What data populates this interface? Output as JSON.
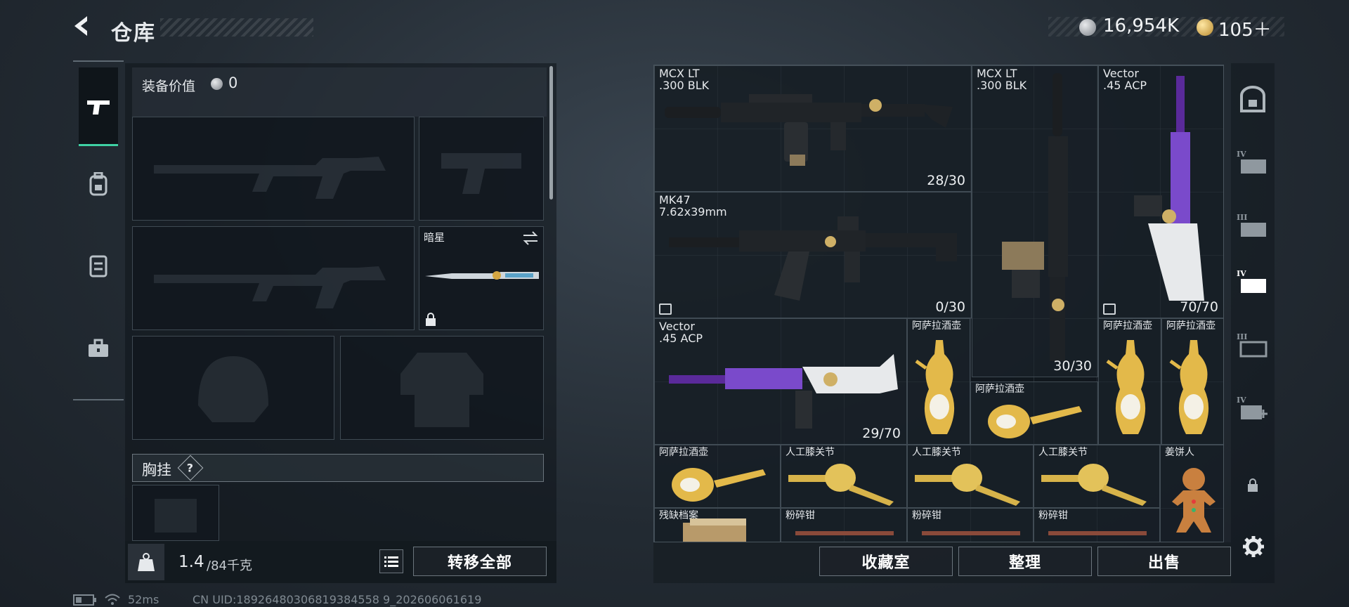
{
  "header": {
    "title": "仓库",
    "currency": [
      {
        "icon": "silver-coin-icon",
        "value": "16,954K"
      },
      {
        "icon": "gold-coin-icon",
        "value": "105＋"
      }
    ]
  },
  "left_tabs": [
    {
      "icon": "pistol-icon",
      "active": true
    },
    {
      "icon": "backpack-icon",
      "active": false
    },
    {
      "icon": "chest-rig-icon",
      "active": false
    },
    {
      "icon": "toolbox-icon",
      "active": false
    }
  ],
  "loadout": {
    "value_label": "装备价值",
    "value": "0",
    "secondary_melee": {
      "name": "暗星",
      "icon": "swap-icon"
    },
    "chest_rig_label": "胸挂",
    "help_icon": "?",
    "weight_current": "1.4",
    "weight_max": "/84千克",
    "transfer_all": "转移全部"
  },
  "grid_items": [
    {
      "name": "MCX LT",
      "sub": ".300 BLK",
      "count": "28/30",
      "kind": "rifle-black"
    },
    {
      "name": "MCX LT",
      "sub": ".300 BLK",
      "count": "30/30",
      "kind": "rifle-black-vertical"
    },
    {
      "name": "Vector",
      "sub": ".45 ACP",
      "count": "70/70",
      "kind": "smg-purple-vertical"
    },
    {
      "name": "MK47",
      "sub": "7.62x39mm",
      "count": "0/30",
      "kind": "rifle-black"
    },
    {
      "name": "Vector",
      "sub": ".45 ACP",
      "count": "29/70",
      "kind": "smg-purple"
    },
    {
      "name": "阿萨拉酒壶",
      "kind": "ewer-upright"
    },
    {
      "name": "阿萨拉酒壶",
      "kind": "ewer-upright"
    },
    {
      "name": "阿萨拉酒壶",
      "kind": "ewer-upright"
    },
    {
      "name": "阿萨拉酒壶",
      "kind": "ewer-lying"
    },
    {
      "name": "阿萨拉酒壶",
      "kind": "ewer-lying"
    },
    {
      "name": "人工膝关节",
      "kind": "knee"
    },
    {
      "name": "人工膝关节",
      "kind": "knee"
    },
    {
      "name": "人工膝关节",
      "kind": "knee"
    },
    {
      "name": "姜饼人",
      "kind": "gingerbread"
    },
    {
      "name": "残缺档案",
      "kind": "files"
    },
    {
      "name": "粉碎钳",
      "kind": "pliers"
    },
    {
      "name": "粉碎钳",
      "kind": "pliers"
    },
    {
      "name": "粉碎钳",
      "kind": "pliers"
    }
  ],
  "right_rail": [
    {
      "icon": "safe-box-icon"
    },
    {
      "icon": "case-tier-iv-icon",
      "tier": "IV"
    },
    {
      "icon": "case-tier-iii-icon",
      "tier": "III"
    },
    {
      "icon": "case-tier-iv-icon",
      "tier": "IV",
      "selected": true
    },
    {
      "icon": "case-tier-iii-icon",
      "tier": "III"
    },
    {
      "icon": "case-tier-iv-add-icon",
      "tier": "IV"
    },
    {
      "icon": "lock-icon"
    },
    {
      "icon": "gear-icon"
    }
  ],
  "bottom_buttons": {
    "collection": "收藏室",
    "sort": "整理",
    "sell": "出售"
  },
  "status": {
    "ping": "52ms",
    "uid": "CN UID:18926480306819384558 9_202606061619"
  }
}
